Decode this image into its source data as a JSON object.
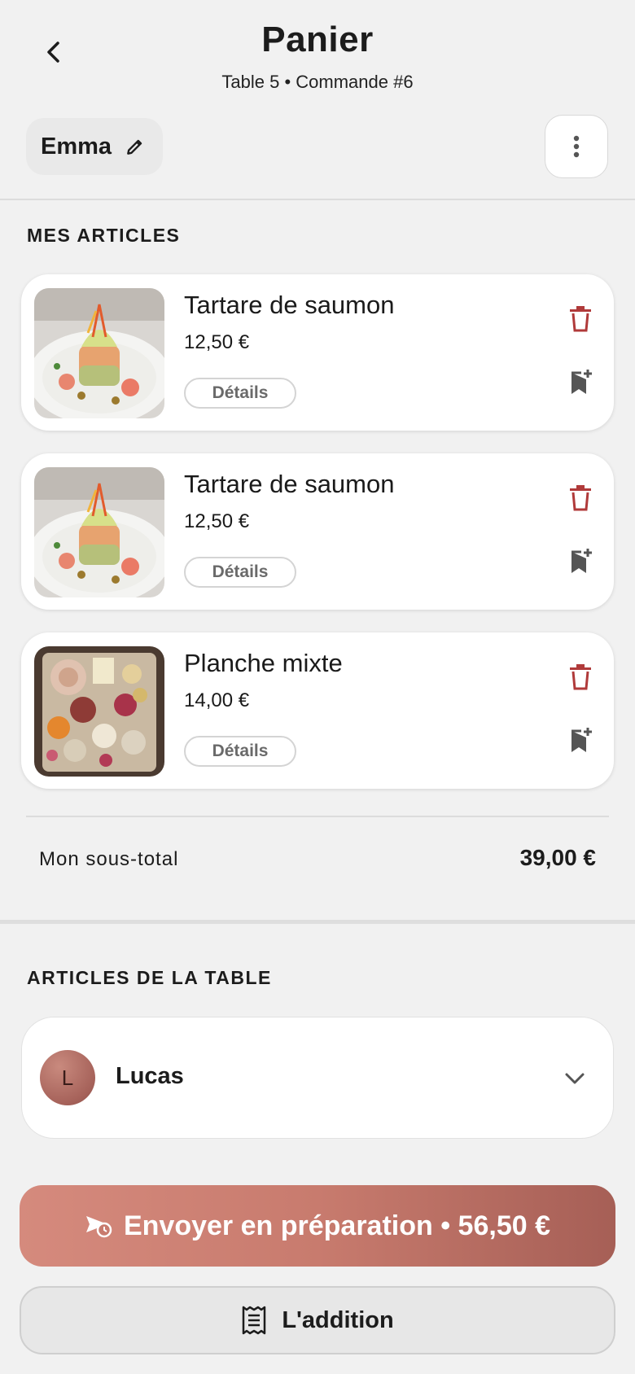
{
  "header": {
    "title": "Panier",
    "subtitle": "Table 5 • Commande #6",
    "user_name": "Emma"
  },
  "my_items": {
    "section_title": "MES ARTICLES",
    "items": [
      {
        "name": "Tartare de saumon",
        "price": "12,50 €",
        "details_label": "Détails",
        "image": "salmon-tartare-photo"
      },
      {
        "name": "Tartare de saumon",
        "price": "12,50 €",
        "details_label": "Détails",
        "image": "salmon-tartare-photo"
      },
      {
        "name": "Planche mixte",
        "price": "14,00 €",
        "details_label": "Détails",
        "image": "charcuterie-board-photo"
      }
    ],
    "subtotal_label": "Mon sous-total",
    "subtotal_value": "39,00 €"
  },
  "table_items": {
    "section_title": "ARTICLES DE LA TABLE",
    "members": [
      {
        "initial": "L",
        "name": "Lucas"
      }
    ]
  },
  "actions": {
    "send_label": "Envoyer en préparation • 56,50 €",
    "bill_label": "L'addition"
  },
  "colors": {
    "accent": "#c87b6e",
    "delete": "#b03a3a",
    "background": "#f1f1f1"
  },
  "icons": [
    "back-chevron-icon",
    "pencil-icon",
    "more-vertical-icon",
    "trash-icon",
    "bookmark-add-icon",
    "chevron-down-icon",
    "send-clock-icon",
    "receipt-icon"
  ]
}
